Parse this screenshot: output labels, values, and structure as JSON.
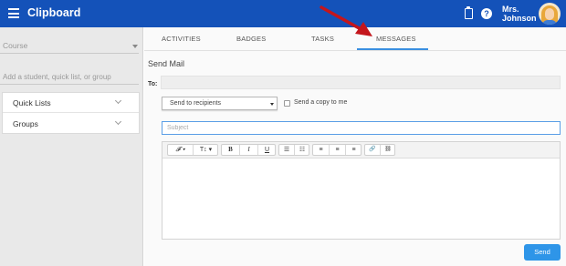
{
  "header": {
    "app_title": "Clipboard",
    "user_first": "Mrs.",
    "user_last": "Johnson",
    "help_symbol": "?"
  },
  "sidebar": {
    "course_label": "Course",
    "search_placeholder": "Add a student, quick list, or group",
    "items": [
      {
        "label": "Quick Lists"
      },
      {
        "label": "Groups"
      }
    ]
  },
  "tabs": [
    {
      "label": "ACTIVITIES"
    },
    {
      "label": "BADGES"
    },
    {
      "label": "TASKS"
    },
    {
      "label": "MESSAGES",
      "active": true
    }
  ],
  "mail": {
    "heading": "Send Mail",
    "to_label": "To:",
    "to_value": "",
    "recipients_select": "Send to recipients",
    "copy_label": "Send a copy to me",
    "copy_checked": false,
    "subject_placeholder": "Subject",
    "subject_value": "",
    "send_label": "Send"
  },
  "editor_toolbar": {
    "font": "𝓕 ▾",
    "size": "T↕ ▾",
    "bold": "B",
    "italic": "I",
    "underline": "U",
    "bullet_list": "☰",
    "numbered_list": "☷",
    "align_left": "≡",
    "align_center": "≡",
    "align_right": "≡",
    "link": "🔗",
    "unlink": "⛓"
  },
  "icons": {
    "menu": "hamburger-icon",
    "clipboard": "clipboard-icon",
    "help": "help-icon",
    "avatar": "avatar",
    "arrow": "annotation-arrow"
  },
  "colors": {
    "header_bg": "#1452b9",
    "accent": "#3a8fe0",
    "send_button": "#2e95e8",
    "arrow": "#c4161c"
  }
}
